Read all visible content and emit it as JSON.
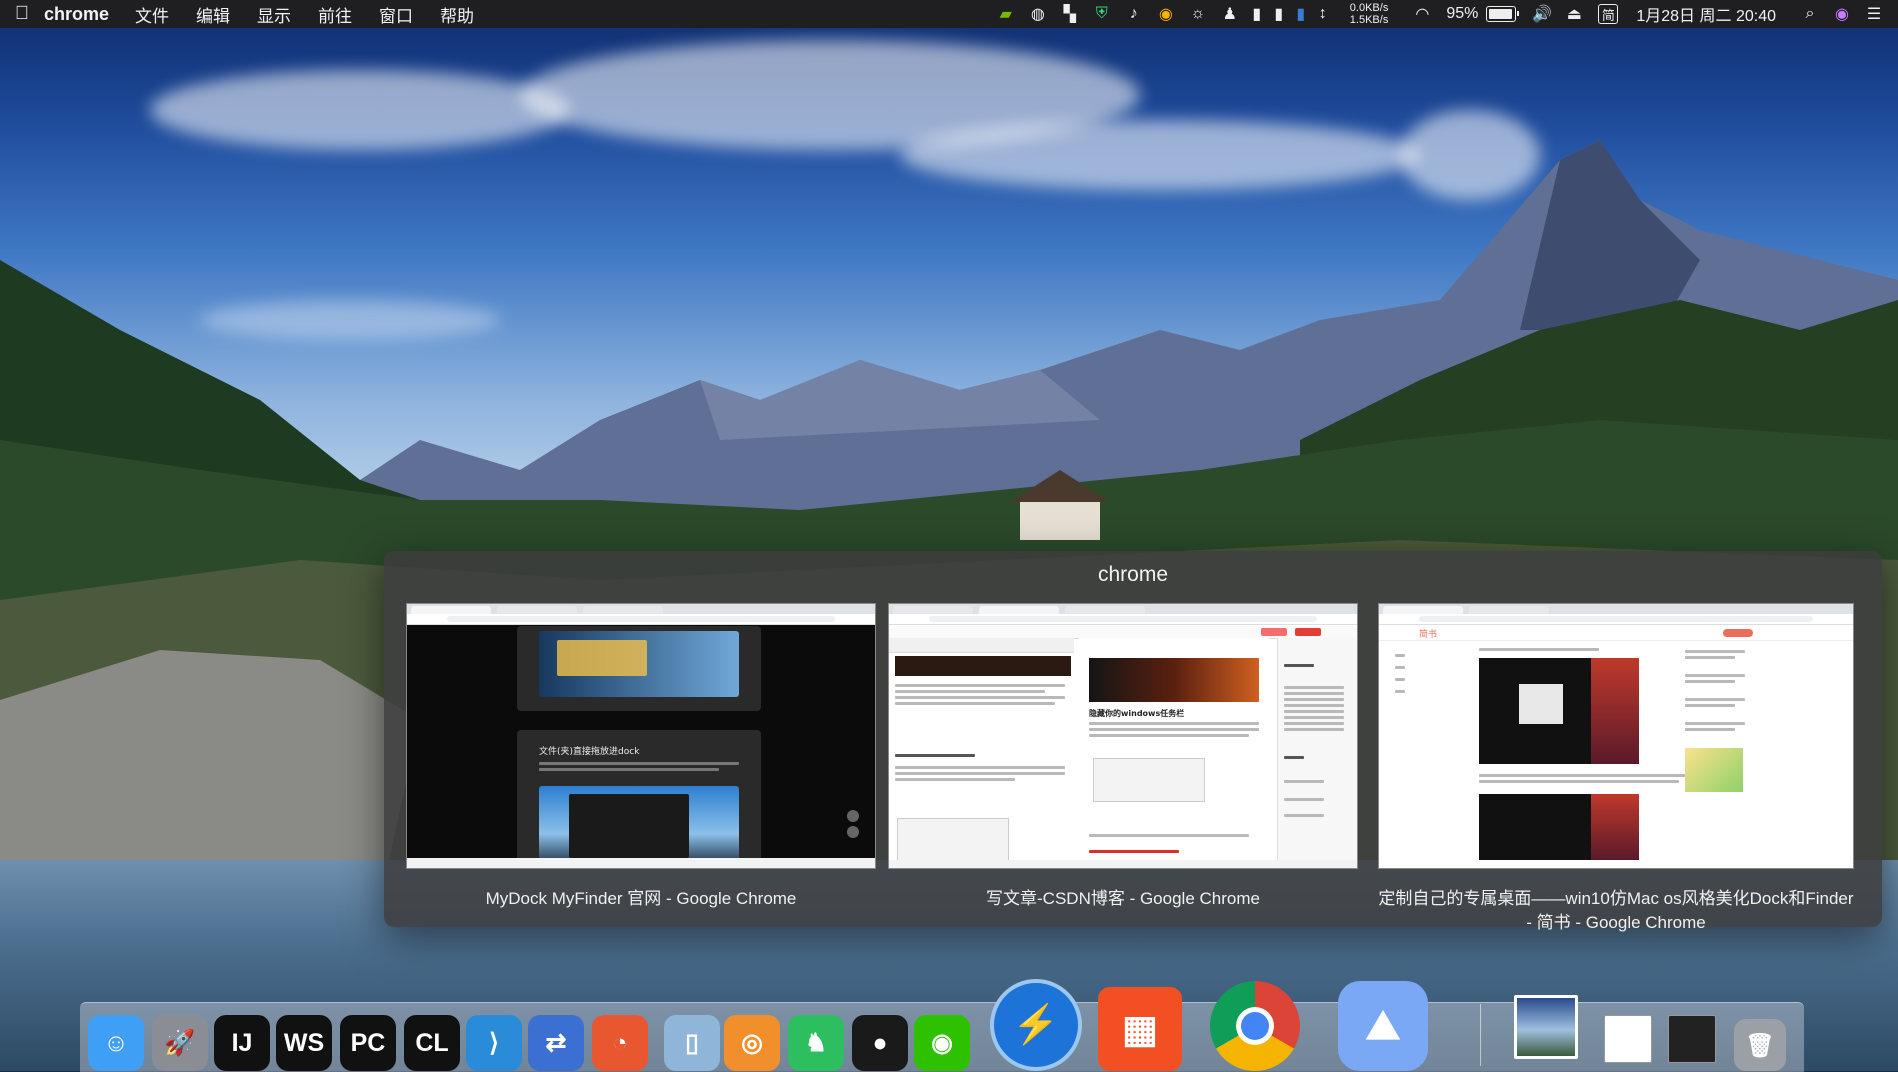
{
  "menubar": {
    "app_name": "chrome",
    "menus": [
      "文件",
      "编辑",
      "显示",
      "前往",
      "窗口",
      "帮助"
    ],
    "net_up": "0.0KB/s",
    "net_down": "1.5KB/s",
    "battery": "95%",
    "battery_level": 0.95,
    "ime": "简",
    "datetime": "1月28日 周二 20:40"
  },
  "switcher": {
    "title": "chrome",
    "windows": [
      {
        "caption": "MyDock MyFinder 官网 - Google Chrome",
        "thumb_heading": "文件(夹)直接拖放进dock"
      },
      {
        "caption": "写文章-CSDN博客 - Google Chrome",
        "thumb_heading": "隐藏你的windows任务栏"
      },
      {
        "caption": "定制自己的专属桌面——win10仿Mac os风格美化Dock和Finder - 简书 - Google Chrome",
        "thumb_heading": "简书"
      }
    ]
  },
  "dock": {
    "items": [
      {
        "name": "finder-icon",
        "label": "☺",
        "color": "#3f9ff5"
      },
      {
        "name": "launchpad-icon",
        "label": "🚀",
        "color": "#8a8d93"
      },
      {
        "name": "intellij-icon",
        "label": "IJ",
        "color": "#111111"
      },
      {
        "name": "webstorm-icon",
        "label": "WS",
        "color": "#111111"
      },
      {
        "name": "pycharm-icon",
        "label": "PC",
        "color": "#111111"
      },
      {
        "name": "clion-icon",
        "label": "CL",
        "color": "#111111"
      },
      {
        "name": "vscode-icon",
        "label": "⟩",
        "color": "#2a8bd8"
      },
      {
        "name": "network-tool-icon",
        "label": "⇄",
        "color": "#3b6fd1"
      },
      {
        "name": "swift-icon",
        "label": "◔",
        "color": "#e8572f"
      },
      {
        "name": "recycle-bin-icon",
        "label": "▯",
        "color": "#8fb6d8"
      },
      {
        "name": "color-app-icon",
        "label": "◎",
        "color": "#f08f2c"
      },
      {
        "name": "evernote-icon",
        "label": "♞",
        "color": "#2dbe60"
      },
      {
        "name": "qq-icon",
        "label": "●",
        "color": "#1a1a1a"
      },
      {
        "name": "wechat-icon",
        "label": "◉",
        "color": "#2dc100"
      },
      {
        "name": "thunder-icon",
        "label": "⚡",
        "color": "#1e73d8"
      },
      {
        "name": "office-icon",
        "label": "▦",
        "color": "#f25022"
      },
      {
        "name": "chrome-icon",
        "label": "◍",
        "color": "#dd4b39"
      },
      {
        "name": "photos-icon",
        "label": "⛰",
        "color": "#7aa8f5"
      },
      {
        "name": "desktop-thumb-icon",
        "label": "",
        "color": "#eaeaea"
      },
      {
        "name": "chrome-window-thumb-icon",
        "label": "",
        "color": "#ffffff"
      },
      {
        "name": "terminal-thumb-icon",
        "label": "",
        "color": "#222222"
      },
      {
        "name": "trash-icon",
        "label": "🗑",
        "color": "#9aa0a6"
      }
    ]
  }
}
